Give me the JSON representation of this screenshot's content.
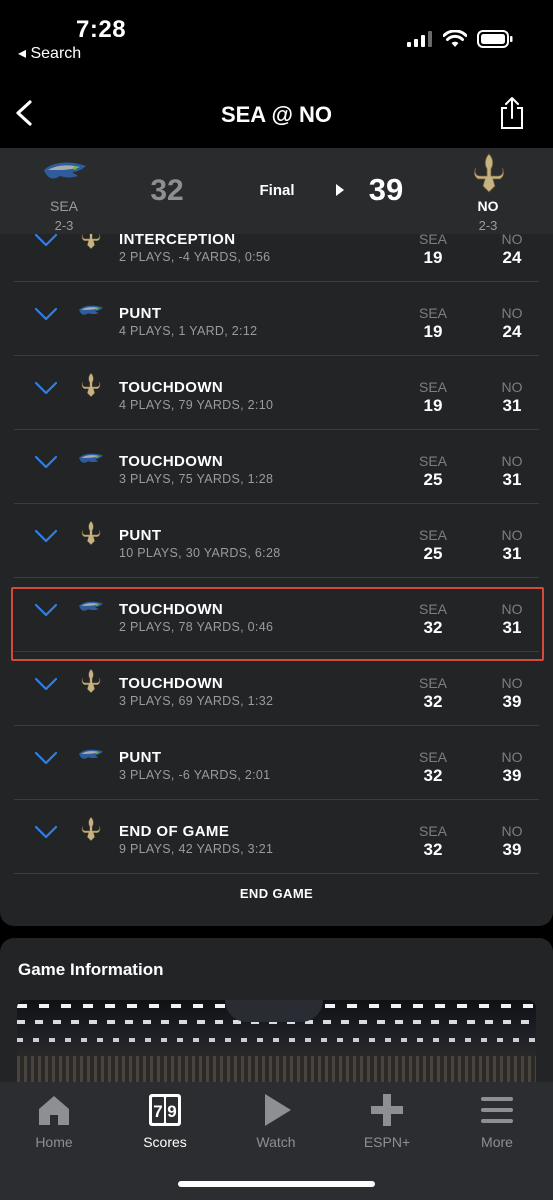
{
  "status_bar": {
    "time": "7:28",
    "back_label": "◂ Search"
  },
  "nav": {
    "title": "SEA @ NO"
  },
  "header": {
    "away": {
      "abbr": "SEA",
      "record": "2-3",
      "score": "32"
    },
    "status": "Final",
    "home": {
      "abbr": "NO",
      "record": "2-3",
      "score": "39"
    }
  },
  "drives": [
    {
      "team": "NO",
      "result": "INTERCEPTION",
      "detail": "2 PLAYS, -4 YARDS, 0:56",
      "away_label": "SEA",
      "away_score": "19",
      "home_label": "NO",
      "home_score": "24"
    },
    {
      "team": "SEA",
      "result": "PUNT",
      "detail": "4 PLAYS, 1 YARD, 2:12",
      "away_label": "SEA",
      "away_score": "19",
      "home_label": "NO",
      "home_score": "24"
    },
    {
      "team": "NO",
      "result": "TOUCHDOWN",
      "detail": "4 PLAYS, 79 YARDS, 2:10",
      "away_label": "SEA",
      "away_score": "19",
      "home_label": "NO",
      "home_score": "31"
    },
    {
      "team": "SEA",
      "result": "TOUCHDOWN",
      "detail": "3 PLAYS, 75 YARDS, 1:28",
      "away_label": "SEA",
      "away_score": "25",
      "home_label": "NO",
      "home_score": "31"
    },
    {
      "team": "NO",
      "result": "PUNT",
      "detail": "10 PLAYS, 30 YARDS, 6:28",
      "away_label": "SEA",
      "away_score": "25",
      "home_label": "NO",
      "home_score": "31"
    },
    {
      "team": "SEA",
      "result": "TOUCHDOWN",
      "detail": "2 PLAYS, 78 YARDS, 0:46",
      "away_label": "SEA",
      "away_score": "32",
      "home_label": "NO",
      "home_score": "31"
    },
    {
      "team": "NO",
      "result": "TOUCHDOWN",
      "detail": "3 PLAYS, 69 YARDS, 1:32",
      "away_label": "SEA",
      "away_score": "32",
      "home_label": "NO",
      "home_score": "39"
    },
    {
      "team": "SEA",
      "result": "PUNT",
      "detail": "3 PLAYS, -6 YARDS, 2:01",
      "away_label": "SEA",
      "away_score": "32",
      "home_label": "NO",
      "home_score": "39"
    },
    {
      "team": "NO",
      "result": "END OF GAME",
      "detail": "9 PLAYS, 42 YARDS, 3:21",
      "away_label": "SEA",
      "away_score": "32",
      "home_label": "NO",
      "home_score": "39"
    }
  ],
  "end_game_label": "END GAME",
  "game_info": {
    "title": "Game Information"
  },
  "tabs": [
    {
      "label": "Home",
      "icon": "home-icon",
      "active": false
    },
    {
      "label": "Scores",
      "icon": "scores-icon",
      "active": true
    },
    {
      "label": "Watch",
      "icon": "play-icon",
      "active": false
    },
    {
      "label": "ESPN+",
      "icon": "plus-icon",
      "active": false
    },
    {
      "label": "More",
      "icon": "menu-icon",
      "active": false
    }
  ],
  "colors": {
    "background": "#000000",
    "card": "#232426",
    "header": "#2a2b2d",
    "accent_blue": "#2f7fe6",
    "highlight_border": "#d8483d",
    "muted_text": "#9a9b9e",
    "saints_gold": "#c6b283",
    "seahawks_navy": "#1d3a6e",
    "seahawks_green": "#69be28"
  }
}
